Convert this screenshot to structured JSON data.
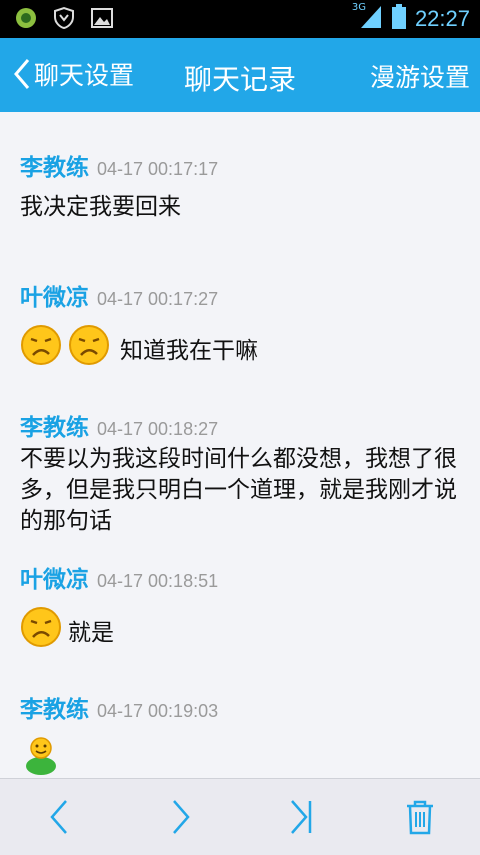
{
  "status_bar": {
    "time": "22:27",
    "network": "3G"
  },
  "header": {
    "back_label": "聊天设置",
    "title": "聊天记录",
    "roam_label": "漫游设置"
  },
  "messages": [
    {
      "sender": "李教练",
      "time": "04-17 00:17:17",
      "text": "我决定我要回来"
    },
    {
      "sender": "叶微凉",
      "time": "04-17 00:17:27",
      "text": "知道我在干嘛",
      "emoji": [
        "sad-face",
        "sad-face"
      ]
    },
    {
      "sender": "李教练",
      "time": "04-17 00:18:27",
      "text": "不要以为我这段时间什么都没想，我想了很多，但是我只明白一个道理，就是我刚才说的那句话"
    },
    {
      "sender": "叶微凉",
      "time": "04-17 00:18:51",
      "text": "就是",
      "emoji": [
        "sad-face"
      ]
    },
    {
      "sender": "李教练",
      "time": "04-17 00:19:03",
      "emoji": [
        "smiley-figure"
      ]
    }
  ],
  "icons": {
    "accent": "#22a7e8",
    "sender_color": "#1aa2e4"
  },
  "bottom_nav": [
    "previous-page",
    "next-page",
    "last-page",
    "delete"
  ]
}
